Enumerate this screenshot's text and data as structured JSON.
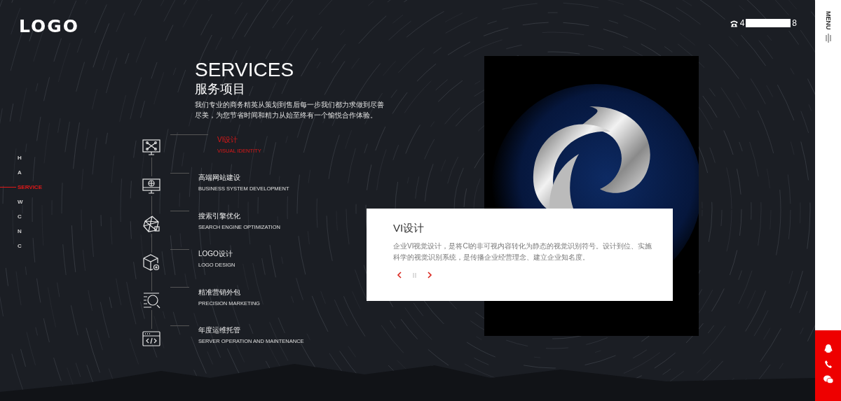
{
  "header": {
    "logo": "LOGO",
    "phone": {
      "start": "4",
      "end": "8"
    }
  },
  "side_nav": [
    {
      "label": "H",
      "selected": false
    },
    {
      "label": "A",
      "selected": false
    },
    {
      "label": "SERVICE",
      "selected": true
    },
    {
      "label": "W",
      "selected": false
    },
    {
      "label": "C",
      "selected": false
    },
    {
      "label": "N",
      "selected": false
    },
    {
      "label": "C",
      "selected": false
    }
  ],
  "intro": {
    "title": "SERVICES",
    "subtitle": "服务项目",
    "text": "我们专业的商务精英从策划到售后每一步我们都力求做到尽善尽美，为您节省时间和精力从始至终有一个愉悦合作体验。"
  },
  "services": [
    {
      "title": "VI设计",
      "subtitle": "VISUAL IDENTITY",
      "selected": true
    },
    {
      "title": "高端网站建设",
      "subtitle": "BUSINESS SYSTEM DEVELOPMENT",
      "selected": false
    },
    {
      "title": "搜索引擎优化",
      "subtitle": "SEARCH ENGINE OPTIMIZATION",
      "selected": false
    },
    {
      "title": "LOGO设计",
      "subtitle": "LOGO DESIGN",
      "selected": false
    },
    {
      "title": "精准营销外包",
      "subtitle": "PRECISION MARKETING",
      "selected": false
    },
    {
      "title": "年度运维托管",
      "subtitle": "SERVER OPERATION AND MAINTENANCE",
      "selected": false
    }
  ],
  "detail": {
    "title": "VI设计",
    "text": "企业VI视觉设计，是将CI的非可视内容转化为静态的视觉识别符号。设计到位、实施科学的视觉识别系统，是传播企业经营理念、建立企业知名度。"
  },
  "menu": {
    "label": "MENU"
  }
}
